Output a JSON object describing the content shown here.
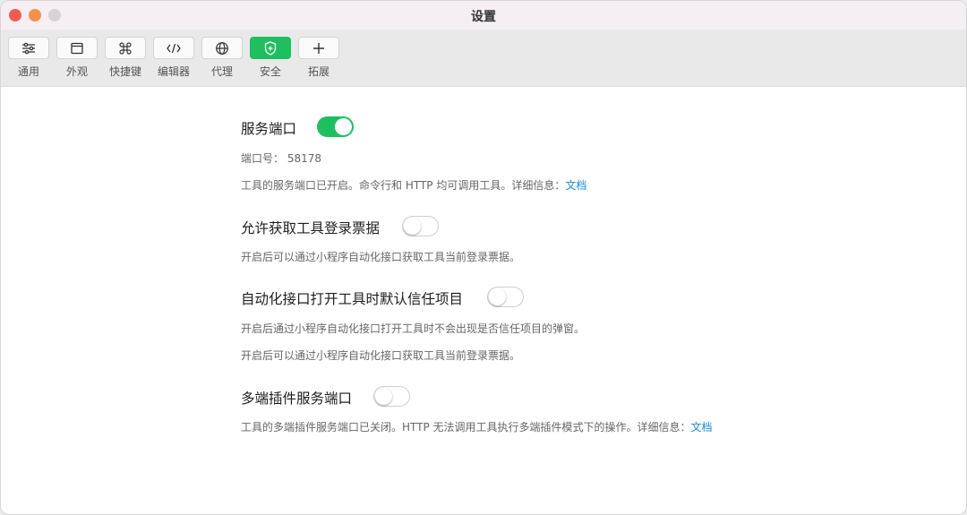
{
  "window": {
    "title": "设置"
  },
  "toolbar": {
    "items": [
      {
        "label": "通用",
        "icon": "sliders-icon"
      },
      {
        "label": "外观",
        "icon": "window-icon"
      },
      {
        "label": "快捷键",
        "icon": "command-key-icon"
      },
      {
        "label": "编辑器",
        "icon": "code-icon"
      },
      {
        "label": "代理",
        "icon": "globe-icon"
      },
      {
        "label": "安全",
        "icon": "shield-icon",
        "active": true
      },
      {
        "label": "拓展",
        "icon": "plus-icon"
      }
    ]
  },
  "settings": {
    "service_port": {
      "title": "服务端口",
      "enabled": true,
      "port_label": "端口号：",
      "port_value": "58178",
      "desc": "工具的服务端口已开启。命令行和 HTTP 均可调用工具。详细信息：",
      "link": "文档"
    },
    "login_ticket": {
      "title": "允许获取工具登录票据",
      "enabled": false,
      "desc": "开启后可以通过小程序自动化接口获取工具当前登录票据。"
    },
    "trust_project": {
      "title": "自动化接口打开工具时默认信任项目",
      "enabled": false,
      "desc1": "开启后通过小程序自动化接口打开工具时不会出现是否信任项目的弹窗。",
      "desc2": "开启后可以通过小程序自动化接口获取工具当前登录票据。"
    },
    "multi_port": {
      "title": "多端插件服务端口",
      "enabled": false,
      "desc": "工具的多端插件服务端口已关闭。HTTP 无法调用工具执行多端插件模式下的操作。详细信息：",
      "link": "文档"
    }
  },
  "colors": {
    "accent": "#1fbf61",
    "link": "#1a8ad6"
  }
}
